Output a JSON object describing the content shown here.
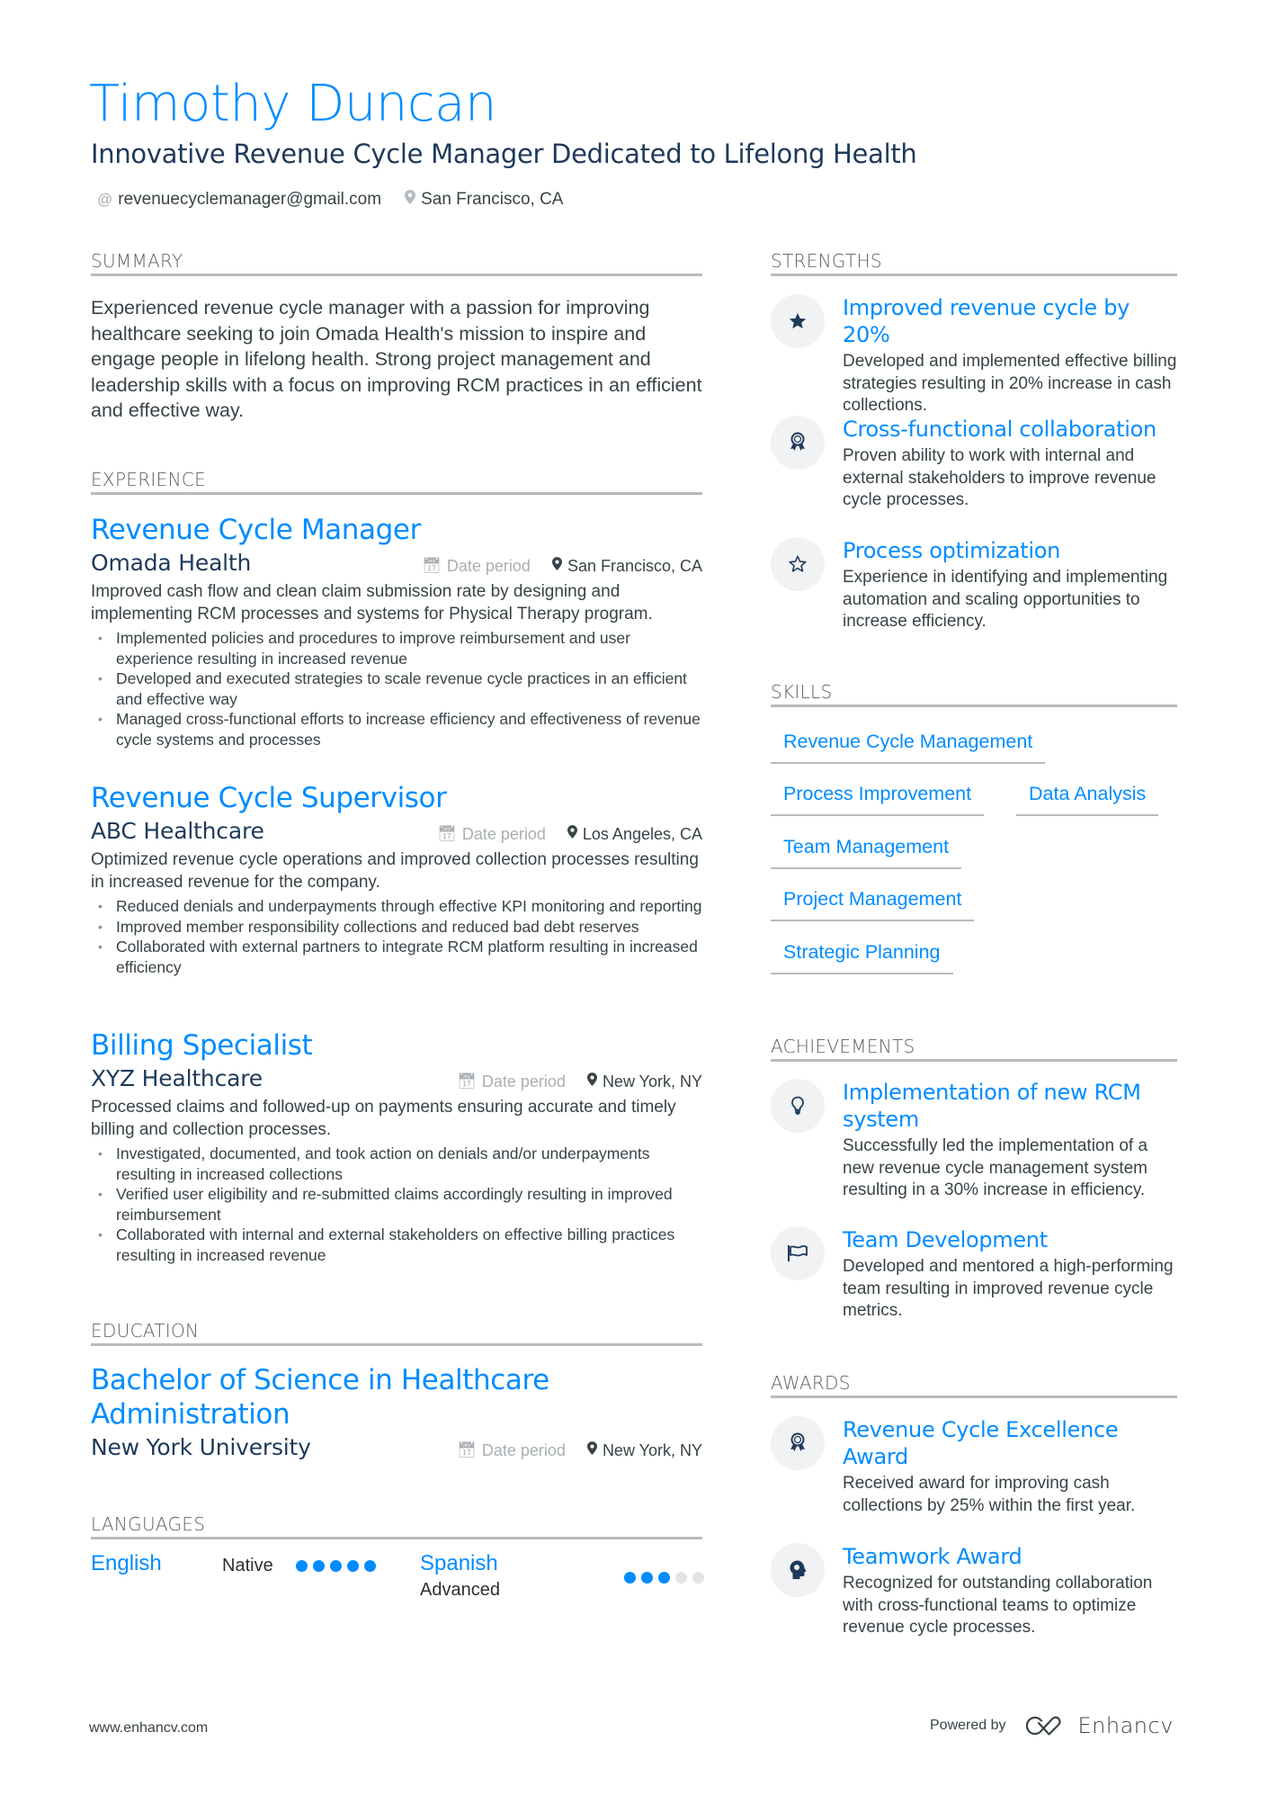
{
  "header": {
    "name": "Timothy Duncan",
    "tagline": "Innovative Revenue Cycle Manager Dedicated to Lifelong Health",
    "email": "revenuecyclemanager@gmail.com",
    "location": "San Francisco, CA",
    "email_icon": "at-icon",
    "location_icon": "map-pin-icon"
  },
  "colors": {
    "accent": "#008cff",
    "heading_dark": "#1e3a5a",
    "text": "#384347",
    "muted": "#a9afb3",
    "rule": "#b7bbbe",
    "icon_bg": "#f1f2f3"
  },
  "summary": {
    "heading": "Summary",
    "text": "Experienced revenue cycle manager with a passion for improving healthcare seeking to join Omada Health's mission to inspire and engage people in lifelong health. Strong project management and leadership skills with a focus on improving RCM practices in an efficient and effective way."
  },
  "experience": {
    "heading": "Experience",
    "jobs": [
      {
        "title": "Revenue Cycle Manager",
        "company": "Omada Health",
        "date": "Date period",
        "location": "San Francisco, CA",
        "description": "Improved cash flow and clean claim submission rate by designing and implementing RCM processes and systems for Physical Therapy program.",
        "bullets": [
          "Implemented policies and procedures to improve reimbursement and user experience resulting in increased revenue",
          "Developed and executed strategies to scale revenue cycle practices in an efficient and effective way",
          "Managed cross-functional efforts to increase efficiency and effectiveness of revenue cycle systems and processes"
        ]
      },
      {
        "title": "Revenue Cycle Supervisor",
        "company": "ABC Healthcare",
        "date": "Date period",
        "location": "Los Angeles, CA",
        "description": "Optimized revenue cycle operations and improved collection processes resulting in increased revenue for the company.",
        "bullets": [
          "Reduced denials and underpayments through effective KPI monitoring and reporting",
          "Improved member responsibility collections and reduced bad debt reserves",
          "Collaborated with external partners to integrate RCM platform resulting in increased efficiency"
        ]
      },
      {
        "title": "Billing Specialist",
        "company": "XYZ Healthcare",
        "date": "Date period",
        "location": "New York, NY",
        "description": "Processed claims and followed-up on payments ensuring accurate and timely billing and collection processes.",
        "bullets": [
          "Investigated, documented, and took action on denials and/or underpayments resulting in increased collections",
          "Verified user eligibility and re-submitted claims accordingly resulting in improved reimbursement",
          "Collaborated with internal and external stakeholders on effective billing practices resulting in increased revenue"
        ]
      }
    ]
  },
  "education": {
    "heading": "Education",
    "degree": "Bachelor of Science in Healthcare Administration",
    "school": "New York University",
    "date": "Date period",
    "location": "New York, NY"
  },
  "languages": {
    "heading": "Languages",
    "items": [
      {
        "name": "English",
        "level": "Native",
        "rating": 5,
        "max": 5
      },
      {
        "name": "Spanish",
        "level": "Advanced",
        "rating": 3,
        "max": 5
      }
    ]
  },
  "strengths": {
    "heading": "Strengths",
    "items": [
      {
        "icon": "star-filled-icon",
        "title": "Improved revenue cycle by 20%",
        "description": "Developed and implemented effective billing strategies resulting in 20% increase in cash collections."
      },
      {
        "icon": "award-ribbon-icon",
        "title": "Cross-functional collaboration",
        "description": "Proven ability to work with internal and external stakeholders to improve revenue cycle processes."
      },
      {
        "icon": "star-outline-icon",
        "title": "Process optimization",
        "description": "Experience in identifying and implementing automation and scaling opportunities to increase efficiency."
      }
    ]
  },
  "skills": {
    "heading": "Skills",
    "items": [
      "Revenue Cycle Management",
      "Process Improvement",
      "Data Analysis",
      "Team Management",
      "Project Management",
      "Strategic Planning"
    ]
  },
  "achievements": {
    "heading": "Achievements",
    "items": [
      {
        "icon": "lightbulb-icon",
        "title": "Implementation of new RCM system",
        "description": "Successfully led the implementation of a new revenue cycle management system resulting in a 30% increase in efficiency."
      },
      {
        "icon": "flag-icon",
        "title": "Team Development",
        "description": "Developed and mentored a high-performing team resulting in improved revenue cycle metrics."
      }
    ]
  },
  "awards": {
    "heading": "Awards",
    "items": [
      {
        "icon": "award-ribbon-icon",
        "title": "Revenue Cycle Excellence Award",
        "description": "Received award for improving cash collections by 25% within the first year."
      },
      {
        "icon": "head-brain-icon",
        "title": "Teamwork Award",
        "description": "Recognized for outstanding collaboration with cross-functional teams to optimize revenue cycle processes."
      }
    ]
  },
  "footer": {
    "website": "www.enhancv.com",
    "powered_by": "Powered by",
    "brand": "Enhancv"
  }
}
